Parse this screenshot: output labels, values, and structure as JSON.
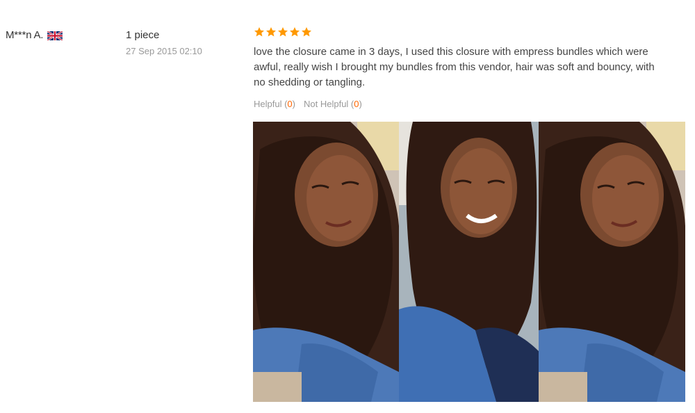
{
  "review": {
    "user": {
      "name": "M***n A.",
      "flag_icon": "uk-flag-icon"
    },
    "order": {
      "quantity": "1 piece",
      "date": "27 Sep 2015 02:10"
    },
    "rating": {
      "stars": 5,
      "max": 5,
      "color": "#f90"
    },
    "text": "love the closure came in 3 days, I used this closure with empress bundles which were awful, really wish I brought my bundles from this vendor, hair was soft and bouncy, with no shedding or tangling.",
    "feedback": {
      "helpful_label": "Helpful",
      "helpful_count": "0",
      "not_helpful_label": "Not Helpful",
      "not_helpful_count": "0"
    },
    "photos": [
      {
        "name": "review-photo-1"
      },
      {
        "name": "review-photo-2"
      },
      {
        "name": "review-photo-3"
      }
    ]
  }
}
